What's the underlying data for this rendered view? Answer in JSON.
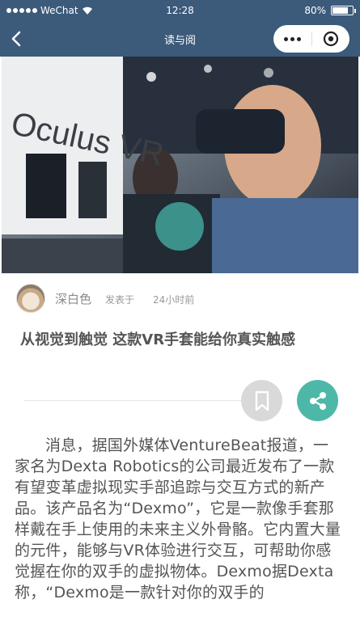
{
  "status_bar": {
    "carrier": "WeChat",
    "time": "12:28",
    "battery": "80%",
    "battery_level": 0.8
  },
  "nav": {
    "title": "读与阅"
  },
  "article": {
    "author": "深白色",
    "posted_label": "发表于",
    "posted_time": "24小时前",
    "title": "从视觉到触觉 这款VR手套能给你真实触感",
    "body": "消息，据国外媒体VentureBeat报道，一家名为Dexta Robotics的公司最近发布了一款有望变革虚拟现实手部追踪与交互方式的新产品。该产品名为“Dexmo”，它是一款像手套那样戴在手上使用的未来主义外骨骼。它内置大量的元件，能够与VR体验进行交互，可帮助你感觉握在你的双手的虚拟物体。Dexmo据Dexta称，“Dexmo是一款针对你的双手的"
  },
  "hero": {
    "sign_text": "Oculus VR"
  },
  "colors": {
    "nav_bg": "#3c5a7a",
    "accent": "#4db8a8",
    "bookmark_bg": "#d9d9d9"
  },
  "icons": {
    "back": "chevron-left-icon",
    "more": "more-dots-icon",
    "close": "target-close-icon",
    "bookmark": "bookmark-icon",
    "share": "share-icon"
  }
}
